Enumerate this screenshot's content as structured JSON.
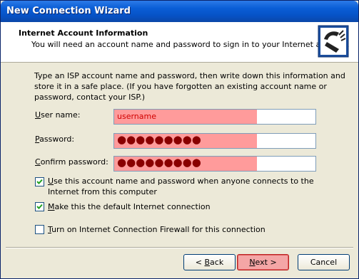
{
  "window": {
    "title": "New Connection Wizard"
  },
  "header": {
    "title": "Internet Account Information",
    "subtitle": "You will need an account name and password to sign in to your Internet account.",
    "icon": "phone-connection-icon"
  },
  "instructions": "Type an ISP account name and password, then write down this information and store it in a safe place. (If you have forgotten an existing account name or password, contact your ISP.)",
  "fields": {
    "username": {
      "label_u": "U",
      "label_rest": "ser name:",
      "value": "username"
    },
    "password": {
      "label_u": "P",
      "label_rest": "assword:",
      "value": "●●●●●●●●●"
    },
    "confirm": {
      "label_u": "C",
      "label_rest": "onfirm password:",
      "value": "●●●●●●●●●"
    }
  },
  "checkboxes": {
    "use_for_all": {
      "label_u": "U",
      "label_rest": "se this account  name and password when anyone connects to the Internet from this computer",
      "checked": true
    },
    "default_conn": {
      "label_u": "M",
      "label_rest": "ake this the default Internet connection",
      "checked": true
    },
    "firewall": {
      "label_u": "T",
      "label_rest": "urn on Internet Connection Firewall for this connection",
      "checked": false
    }
  },
  "buttons": {
    "back": {
      "arrow": "< ",
      "u": "B",
      "rest": "ack"
    },
    "next": {
      "u": "N",
      "rest": "ext >"
    },
    "cancel": "Cancel"
  },
  "colors": {
    "titlebar": "#0a5ed6",
    "highlight": "#ff9b9b"
  }
}
